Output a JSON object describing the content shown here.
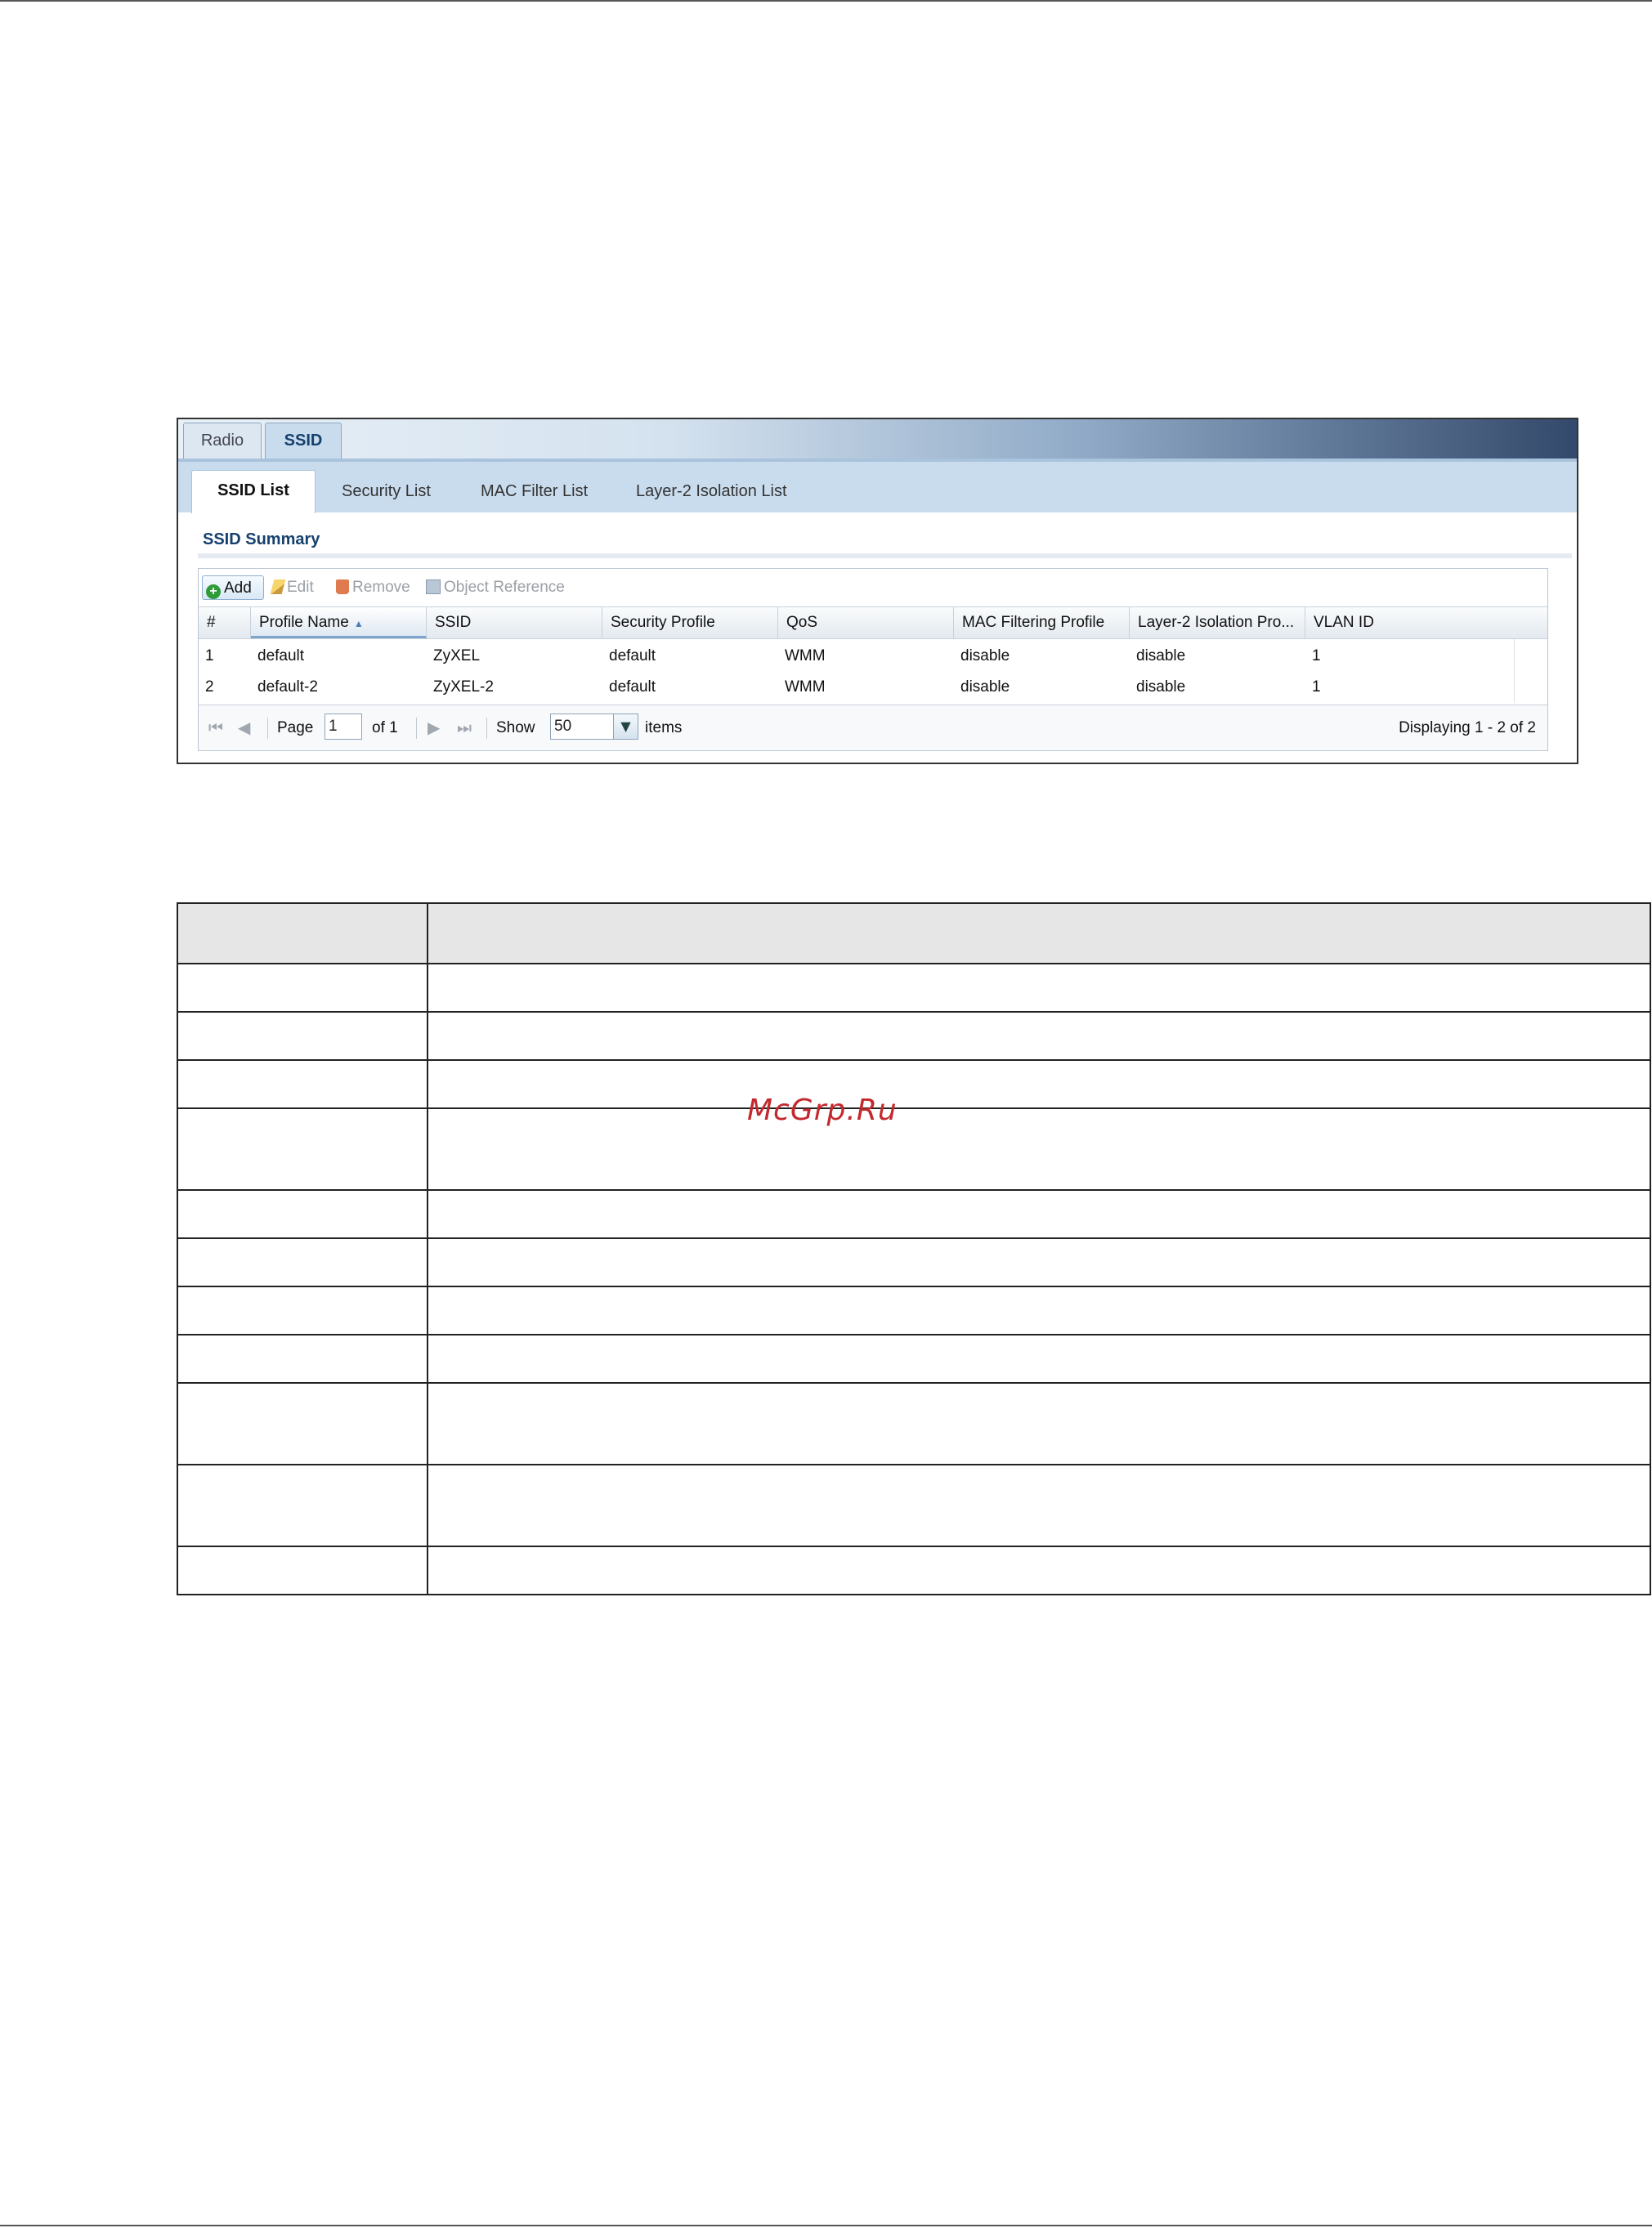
{
  "tabs": {
    "top": [
      "Radio",
      "SSID"
    ],
    "sub": [
      "SSID List",
      "Security List",
      "MAC Filter List",
      "Layer-2 Isolation List"
    ]
  },
  "section_title": "SSID Summary",
  "toolbar": {
    "add": "Add",
    "edit": "Edit",
    "remove": "Remove",
    "object_reference": "Object Reference"
  },
  "table": {
    "columns": [
      "#",
      "Profile Name",
      "SSID",
      "Security Profile",
      "QoS",
      "MAC Filtering Profile",
      "Layer-2 Isolation Pro...",
      "VLAN ID"
    ],
    "rows": [
      [
        "1",
        "default",
        "ZyXEL",
        "default",
        "WMM",
        "disable",
        "disable",
        "1"
      ],
      [
        "2",
        "default-2",
        "ZyXEL-2",
        "default",
        "WMM",
        "disable",
        "disable",
        "1"
      ]
    ]
  },
  "pager": {
    "page_label": "Page",
    "page_value": "1",
    "of_label": "of 1",
    "show_label": "Show",
    "show_value": "50",
    "items_label": "items",
    "displaying": "Displaying 1 - 2 of 2"
  },
  "watermark": "McGrp.Ru",
  "colors": {
    "accent": "#16406d",
    "tab_bg": "#c9dcee",
    "watermark": "#c4292e"
  }
}
